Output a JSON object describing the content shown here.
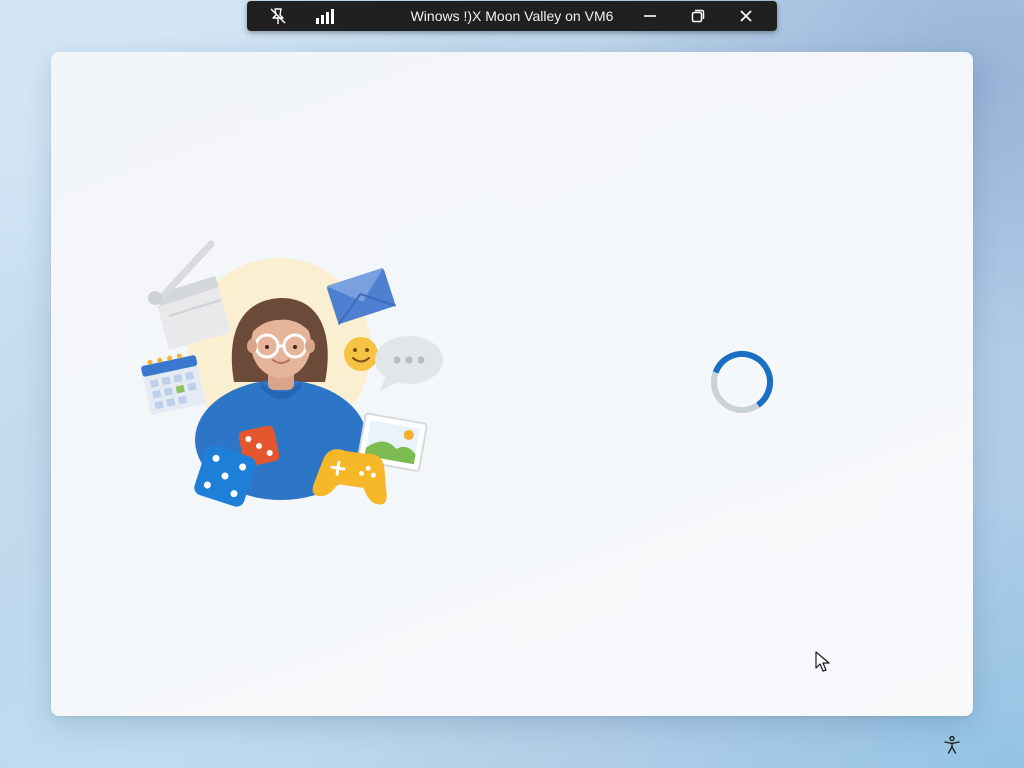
{
  "connection_bar": {
    "title": "Winows !)X Moon Valley on VM6",
    "background_color": "#202020",
    "icons": {
      "pin": "unpin-icon",
      "signal": "signal-strength-icon",
      "minimize": "minimize-icon",
      "restore": "restore-icon",
      "close": "close-icon"
    }
  },
  "oobe": {
    "illustration": "person-with-apps-illustration",
    "loading_indicator": "progress-ring-spinner",
    "accent_color": "#1a6fc4",
    "track_color": "#c9d1d9"
  },
  "taskbar": {
    "accessibility_icon": "accessibility-icon"
  }
}
